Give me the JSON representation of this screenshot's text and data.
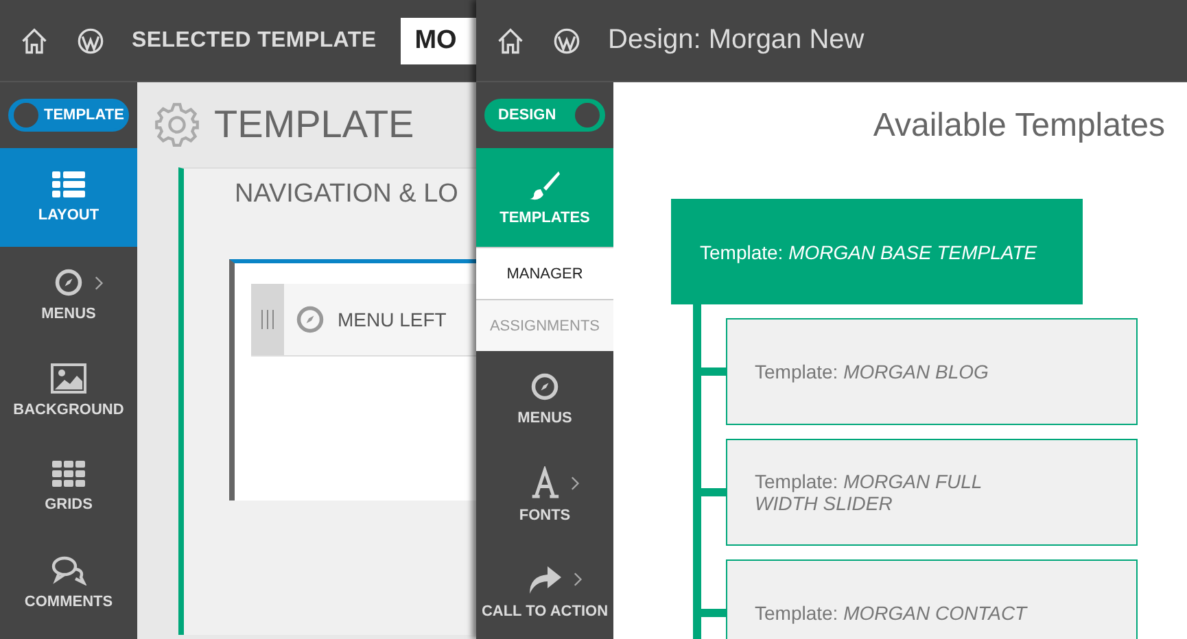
{
  "left_screen": {
    "top_bar": {
      "title": "SELECTED TEMPLATE",
      "template_name": "MO"
    },
    "toggle": {
      "label": "TEMPLATE",
      "on": false
    },
    "sidebar": {
      "items": [
        {
          "label": "LAYOUT",
          "selected": true,
          "has_submenu": false
        },
        {
          "label": "MENUS",
          "selected": false,
          "has_submenu": true
        },
        {
          "label": "BACKGROUND",
          "selected": false,
          "has_submenu": false
        },
        {
          "label": "GRIDS",
          "selected": false,
          "has_submenu": false
        },
        {
          "label": "COMMENTS",
          "selected": false,
          "has_submenu": false
        }
      ]
    },
    "heading": "TEMPLATE",
    "section": {
      "title": "NAVIGATION & LO",
      "menu_item": "MENU LEFT"
    }
  },
  "right_screen": {
    "top_bar": {
      "title": "Design: Morgan New"
    },
    "toggle": {
      "label": "DESIGN",
      "on": true
    },
    "sidebar": {
      "items": [
        {
          "label": "TEMPLATES",
          "selected": true,
          "has_submenu": false,
          "children": [
            {
              "label": "MANAGER",
              "selected": true
            },
            {
              "label": "ASSIGNMENTS",
              "selected": false
            }
          ]
        },
        {
          "label": "MENUS",
          "selected": false,
          "has_submenu": false
        },
        {
          "label": "FONTS",
          "selected": false,
          "has_submenu": true
        },
        {
          "label": "CALL TO ACTION",
          "selected": false,
          "has_submenu": true
        }
      ]
    },
    "heading": "Available Templates",
    "tree": {
      "label": "Template: *MORGAN BASE TEMPLATE*",
      "children": [
        {
          "label": "Template: *MORGAN BLOG*"
        },
        {
          "label": "Template: *MORGAN FULL WIDTH SLIDER*"
        },
        {
          "label": "Template: *MORGAN CONTACT*"
        }
      ]
    }
  }
}
